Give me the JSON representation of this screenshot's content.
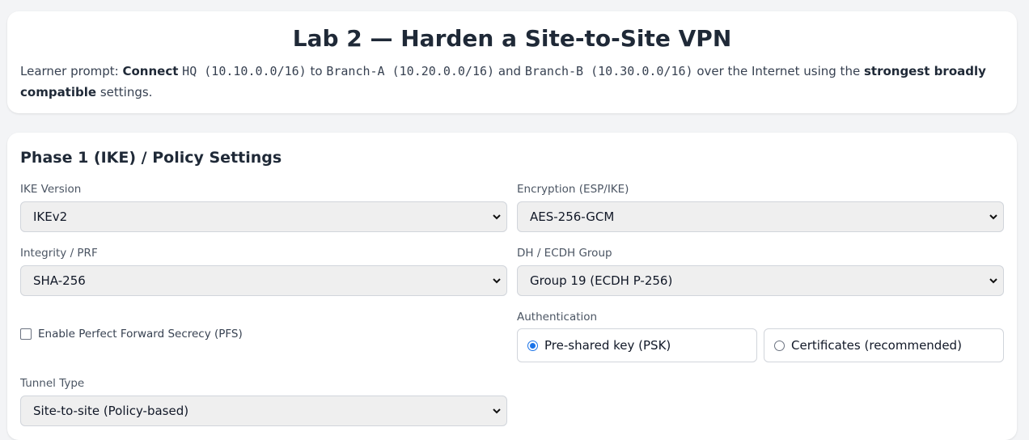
{
  "header": {
    "title": "Lab 2 — Harden a Site-to-Site VPN",
    "prompt_label": "Learner prompt:",
    "prompt_connect": "Connect",
    "hq": "HQ (10.10.0.0/16)",
    "to": "to",
    "branch_a": "Branch-A (10.20.0.0/16)",
    "and": "and",
    "branch_b": "Branch-B (10.30.0.0/16)",
    "over": "over the Internet using the",
    "strongest": "strongest broadly compatible",
    "settings": "settings."
  },
  "phase1": {
    "title": "Phase 1 (IKE) / Policy Settings",
    "ike_version": {
      "label": "IKE Version",
      "value": "IKEv2"
    },
    "encryption": {
      "label": "Encryption (ESP/IKE)",
      "value": "AES-256-GCM"
    },
    "integrity": {
      "label": "Integrity / PRF",
      "value": "SHA-256"
    },
    "dh_group": {
      "label": "DH / ECDH Group",
      "value": "Group 19 (ECDH P-256)"
    },
    "pfs": {
      "label": "Enable Perfect Forward Secrecy (PFS)",
      "checked": false
    },
    "authentication": {
      "label": "Authentication",
      "options": [
        {
          "label": "Pre-shared key (PSK)",
          "selected": true
        },
        {
          "label": "Certificates (recommended)",
          "selected": false
        }
      ]
    },
    "tunnel_type": {
      "label": "Tunnel Type",
      "value": "Site-to-site (Policy-based)"
    }
  },
  "icons": {
    "select_arrow": "chevron-down-icon"
  },
  "colors": {
    "accent": "#1a73e8",
    "background": "#f3f4f6",
    "card": "#ffffff"
  }
}
